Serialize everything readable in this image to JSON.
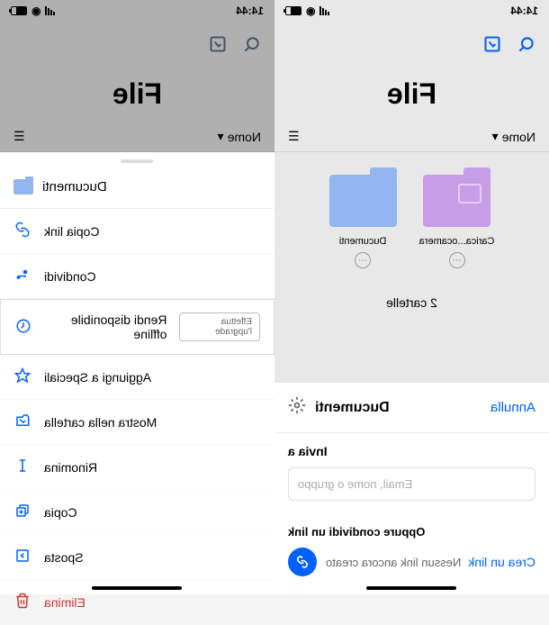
{
  "status": {
    "time": "14:44"
  },
  "title": "File",
  "sort": {
    "label": "Nome"
  },
  "folders": [
    {
      "label": "Carica...ocamera"
    },
    {
      "label": "Ducumenti"
    }
  ],
  "folder_count": "2 cartelle",
  "share": {
    "title": "Ducumenti",
    "cancel": "Annulla",
    "send_to": "Invia a",
    "placeholder": "Email, nome o gruppo",
    "or_share": "Oppure condividi un link",
    "create_link": "Crea un link",
    "no_link": "Nessun link ancora creato"
  },
  "menu": {
    "folder_name": "Ducumenti",
    "items": {
      "copy_link": "Copia link",
      "share": "Condividi",
      "offline": "Rendi disponibile offline",
      "upgrade": "Effettua l'upgrade",
      "starred": "Aggiungi a Speciali",
      "show_folder": "Mostra nella cartella",
      "rename": "Rinomina",
      "copy": "Copia",
      "move": "Sposta",
      "delete": "Elimina"
    }
  }
}
